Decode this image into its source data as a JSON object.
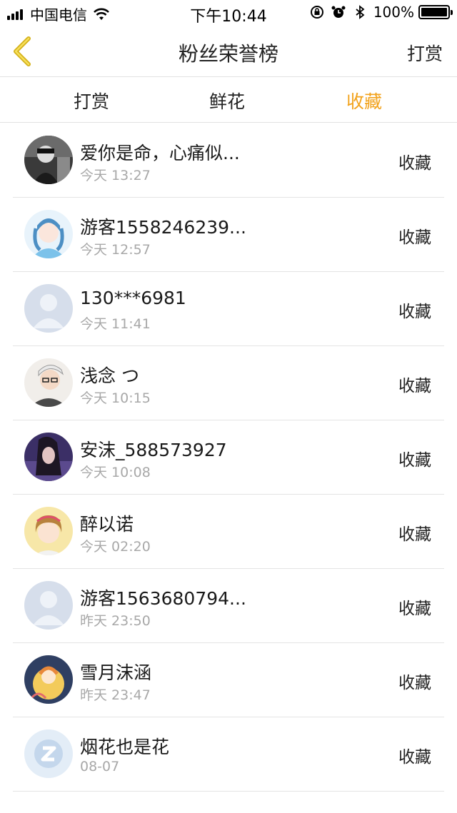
{
  "status_bar": {
    "carrier": "中国电信",
    "time": "下午10:44",
    "battery": "100%"
  },
  "nav": {
    "title": "粉丝荣誉榜",
    "right_label": "打赏"
  },
  "tabs": [
    {
      "label": "打赏",
      "active": false
    },
    {
      "label": "鲜花",
      "active": false
    },
    {
      "label": "收藏",
      "active": true
    }
  ],
  "accent_color": "#f2a21b",
  "list": [
    {
      "name": "爱你是命，心痛似...",
      "time": "今天 13:27",
      "action": "收藏",
      "avatar": "dark-photo"
    },
    {
      "name": "游客1558246239...",
      "time": "今天 12:57",
      "action": "收藏",
      "avatar": "anime-girl-blue"
    },
    {
      "name": "130***6981",
      "time": "今天 11:41",
      "action": "收藏",
      "avatar": "default-person"
    },
    {
      "name": "浅念 つ",
      "time": "今天 10:15",
      "action": "收藏",
      "avatar": "boy-glasses"
    },
    {
      "name": "安沫_588573927",
      "time": "今天 10:08",
      "action": "收藏",
      "avatar": "girl-purple"
    },
    {
      "name": "醉以诺",
      "time": "今天 02:20",
      "action": "收藏",
      "avatar": "girl-headband"
    },
    {
      "name": "游客1563680794...",
      "time": "昨天 23:50",
      "action": "收藏",
      "avatar": "default-person"
    },
    {
      "name": "雪月沫涵",
      "time": "昨天 23:47",
      "action": "收藏",
      "avatar": "anime-yellow"
    },
    {
      "name": "烟花也是花",
      "time": "08-07",
      "action": "收藏",
      "avatar": "qq-logo"
    }
  ]
}
